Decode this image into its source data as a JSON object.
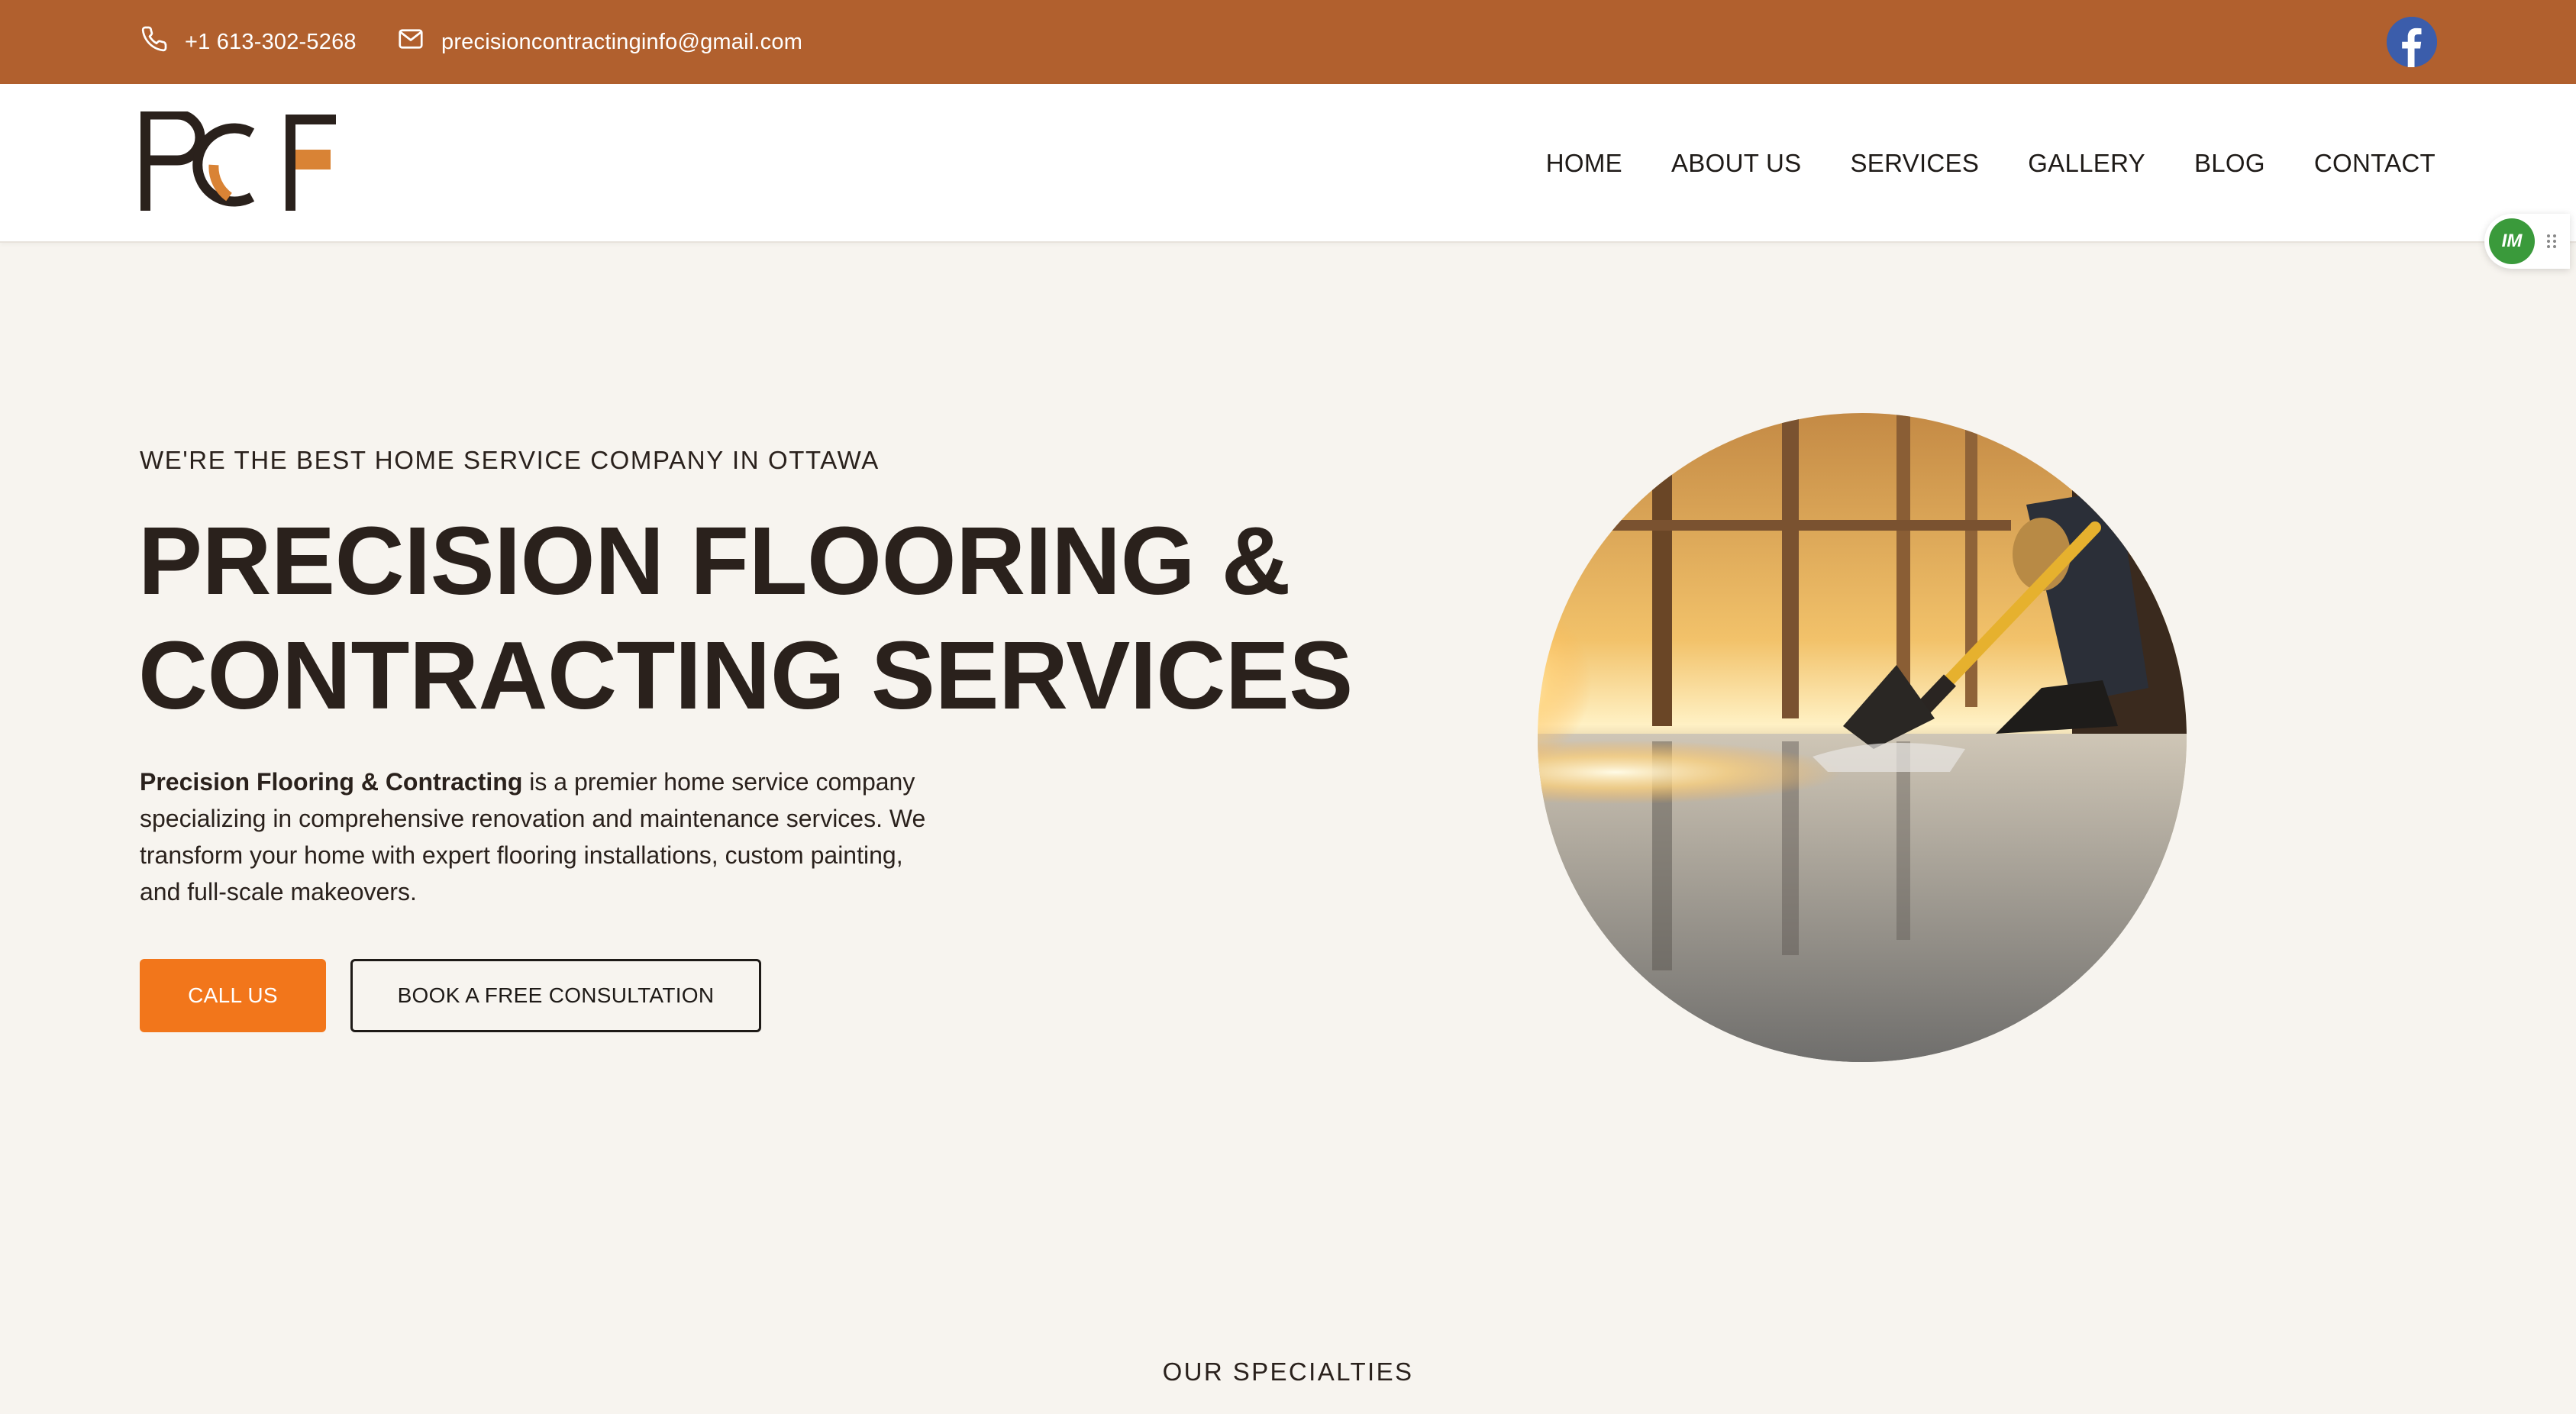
{
  "topbar": {
    "phone": "+1 613-302-5268",
    "email": "precisioncontractinginfo@gmail.com",
    "icons": {
      "phone": "phone-icon",
      "email": "mail-icon",
      "social": "facebook-icon"
    }
  },
  "header": {
    "logo_text": "PCF",
    "nav": [
      {
        "label": "HOME"
      },
      {
        "label": "ABOUT US"
      },
      {
        "label": "SERVICES"
      },
      {
        "label": "GALLERY"
      },
      {
        "label": "BLOG"
      },
      {
        "label": "CONTACT"
      }
    ]
  },
  "widget": {
    "badge": "IM"
  },
  "hero": {
    "eyebrow": "WE'RE THE BEST HOME SERVICE COMPANY IN OTTAWA",
    "title_line1": "PRECISION FLOORING &",
    "title_line2": "CONTRACTING SERVICES",
    "desc_bold": "Precision Flooring & Contracting",
    "desc_rest": " is a premier home service company specializing in comprehensive renovation and maintenance services. We transform your home with expert flooring installations, custom painting, and full-scale makeovers.",
    "call_label": "CALL US",
    "book_label": "BOOK A FREE CONSULTATION"
  },
  "sections": {
    "specialties_heading": "OUR SPECIALTIES"
  },
  "colors": {
    "topbar": "#b1602e",
    "accent": "#f2761b",
    "background": "#f7f4ef",
    "text": "#2a211c",
    "facebook": "#3b5dab"
  }
}
